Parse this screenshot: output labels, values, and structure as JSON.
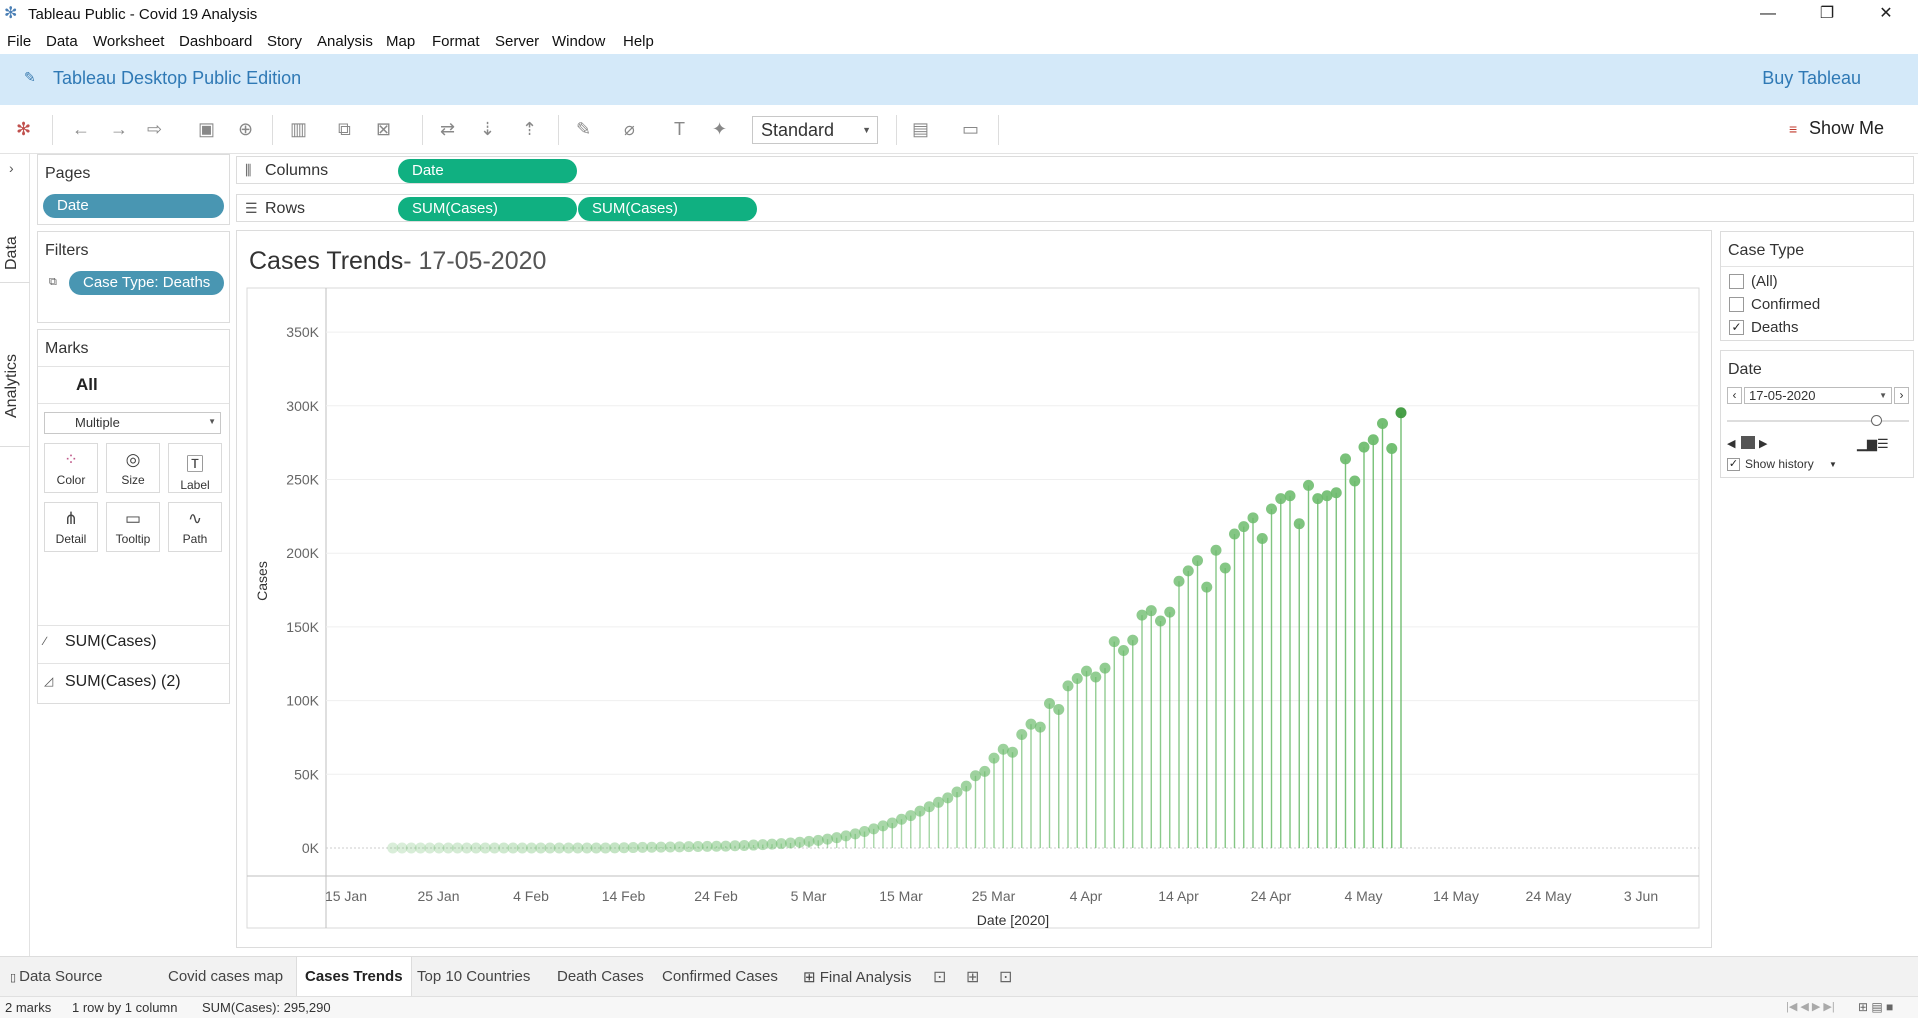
{
  "window": {
    "title": "Tableau Public - Covid 19 Analysis",
    "minimize": "—",
    "maximize": "❐",
    "close": "✕"
  },
  "menu": [
    "File",
    "Data",
    "Worksheet",
    "Dashboard",
    "Story",
    "Analysis",
    "Map",
    "Format",
    "Server",
    "Window",
    "Help"
  ],
  "banner": {
    "edition": "Tableau Desktop Public Edition",
    "buy": "Buy Tableau"
  },
  "toolbar": {
    "fit_select": "Standard",
    "show_me": "Show Me"
  },
  "side_tabs": {
    "data": "Data",
    "analytics": "Analytics"
  },
  "pages": {
    "title": "Pages",
    "pill": "Date"
  },
  "filters": {
    "title": "Filters",
    "pill": "Case Type: Deaths"
  },
  "marks": {
    "title": "Marks",
    "all": "All",
    "type": "Multiple",
    "buttons": [
      "Color",
      "Size",
      "Label",
      "Detail",
      "Tooltip",
      "Path"
    ],
    "layers": [
      "SUM(Cases)",
      "SUM(Cases) (2)"
    ]
  },
  "shelves": {
    "columns_label": "Columns",
    "columns_pill": "Date",
    "rows_label": "Rows",
    "rows_pills": [
      "SUM(Cases)",
      "SUM(Cases)"
    ]
  },
  "viz": {
    "title": "Cases Trends",
    "subtitle": "- 17-05-2020"
  },
  "case_type_filter": {
    "title": "Case Type",
    "options": [
      {
        "label": "(All)",
        "checked": false
      },
      {
        "label": "Confirmed",
        "checked": false
      },
      {
        "label": "Deaths",
        "checked": true
      }
    ]
  },
  "date_control": {
    "title": "Date",
    "value": "17-05-2020",
    "show_history": "Show history",
    "show_history_checked": true
  },
  "sheet_tabs": {
    "data_source": "Data Source",
    "tabs": [
      "Covid cases map",
      "Cases Trends",
      "Top 10 Countries",
      "Death Cases",
      "Confirmed Cases",
      "Final Analysis"
    ],
    "active": "Cases Trends"
  },
  "status": {
    "marks": "2 marks",
    "rows": "1 row by 1 column",
    "sum": "SUM(Cases): 295,290"
  },
  "colors": {
    "accent_green": "#10b081",
    "pill_blue": "#4996b2",
    "mark_green": "#6cbb6c",
    "banner_bg": "#d4e9f9"
  },
  "chart_data": {
    "type": "line",
    "title": "Cases Trends",
    "xlabel": "Date [2020]",
    "ylabel": "Cases",
    "x_ticks": [
      "15 Jan",
      "25 Jan",
      "4 Feb",
      "14 Feb",
      "24 Feb",
      "5 Mar",
      "15 Mar",
      "25 Mar",
      "4 Apr",
      "14 Apr",
      "24 Apr",
      "4 May",
      "14 May",
      "24 May",
      "3 Jun"
    ],
    "y_ticks": [
      "0K",
      "50K",
      "100K",
      "150K",
      "200K",
      "250K",
      "300K",
      "350K"
    ],
    "ylim": [
      0,
      350000
    ],
    "x_start": "2020-01-22",
    "x_end": "2020-05-17",
    "series": [
      {
        "values": [
          0,
          0,
          0,
          0,
          0,
          0,
          0,
          0,
          0,
          0,
          0,
          0,
          0,
          0,
          0,
          0,
          0,
          0,
          0,
          0,
          0,
          0,
          0,
          0,
          100,
          200,
          300,
          400,
          500,
          600,
          700,
          800,
          900,
          1000,
          1100,
          1200,
          1300,
          1500,
          1700,
          2000,
          2300,
          2600,
          3000,
          3400,
          3900,
          4500,
          5200,
          6000,
          7000,
          8200,
          9600,
          11200,
          13000,
          15000,
          17000,
          19500,
          22000,
          25000,
          28000,
          31000,
          34000,
          38000,
          42000,
          49000,
          52000,
          61000,
          67000,
          65000,
          77000,
          84000,
          82000,
          98000,
          94000,
          110000,
          115000,
          120000,
          116000,
          122000,
          140000,
          134000,
          141000,
          158000,
          161000,
          154000,
          160000,
          181000,
          188000,
          195000,
          177000,
          202000,
          190000,
          213000,
          218000,
          224000,
          210000,
          230000,
          237000,
          239000,
          220000,
          246000,
          237000,
          239000,
          241000,
          264000,
          249000,
          272000,
          277000,
          288000,
          271000,
          295290
        ]
      }
    ]
  }
}
